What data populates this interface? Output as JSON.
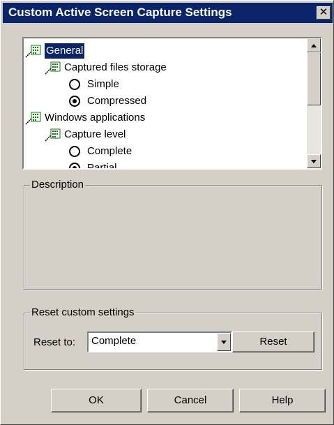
{
  "window": {
    "title": "Custom Active Screen Capture Settings",
    "close_symbol": "✕"
  },
  "tree": {
    "items": [
      {
        "kind": "folder",
        "label": "General",
        "selected": true,
        "icon": "settings-folder-icon"
      },
      {
        "kind": "folder",
        "label": "Captured files storage",
        "icon": "settings-folder-icon"
      },
      {
        "kind": "radio",
        "label": "Simple",
        "checked": false
      },
      {
        "kind": "radio",
        "label": "Compressed",
        "checked": true
      },
      {
        "kind": "folder",
        "label": "Windows applications",
        "icon": "settings-folder-icon"
      },
      {
        "kind": "folder",
        "label": "Capture level",
        "icon": "settings-folder-icon"
      },
      {
        "kind": "radio",
        "label": "Complete",
        "checked": false
      },
      {
        "kind": "radio",
        "label": "Partial",
        "checked": true
      }
    ]
  },
  "description": {
    "group_label": "Description",
    "text": ""
  },
  "reset": {
    "group_label": "Reset custom settings",
    "reset_to_label": "Reset to:",
    "selected_value": "Complete",
    "reset_button": "Reset"
  },
  "buttons": {
    "ok": "OK",
    "cancel": "Cancel",
    "help": "Help"
  },
  "colors": {
    "titlebar": "#0a246a",
    "dialog_bg": "#d4d0c8",
    "selection": "#0a246a"
  }
}
